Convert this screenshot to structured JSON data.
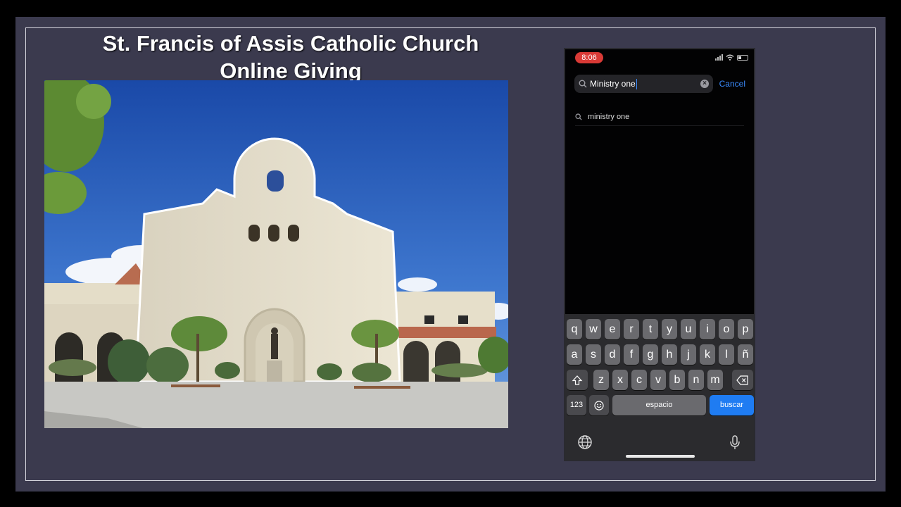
{
  "slide": {
    "title_line1": "St. Francis of Assis Catholic Church",
    "title_line2": "Online Giving"
  },
  "phone": {
    "status": {
      "time": "8:06"
    },
    "search": {
      "value": "Ministry one",
      "cancel_label": "Cancel"
    },
    "suggestions": [
      {
        "text": "ministry one"
      }
    ],
    "keyboard": {
      "row1": [
        "q",
        "w",
        "e",
        "r",
        "t",
        "y",
        "u",
        "i",
        "o",
        "p"
      ],
      "row2": [
        "a",
        "s",
        "d",
        "f",
        "g",
        "h",
        "j",
        "k",
        "l",
        "ñ"
      ],
      "row3": [
        "z",
        "x",
        "c",
        "v",
        "b",
        "n",
        "m"
      ],
      "numbers_label": "123",
      "space_label": "espacio",
      "search_label": "buscar"
    }
  },
  "colors": {
    "slide_bg": "#3b3a4e",
    "accent_blue": "#3b8cff",
    "search_key": "#1f7cf2",
    "time_pill": "#d93a36"
  }
}
